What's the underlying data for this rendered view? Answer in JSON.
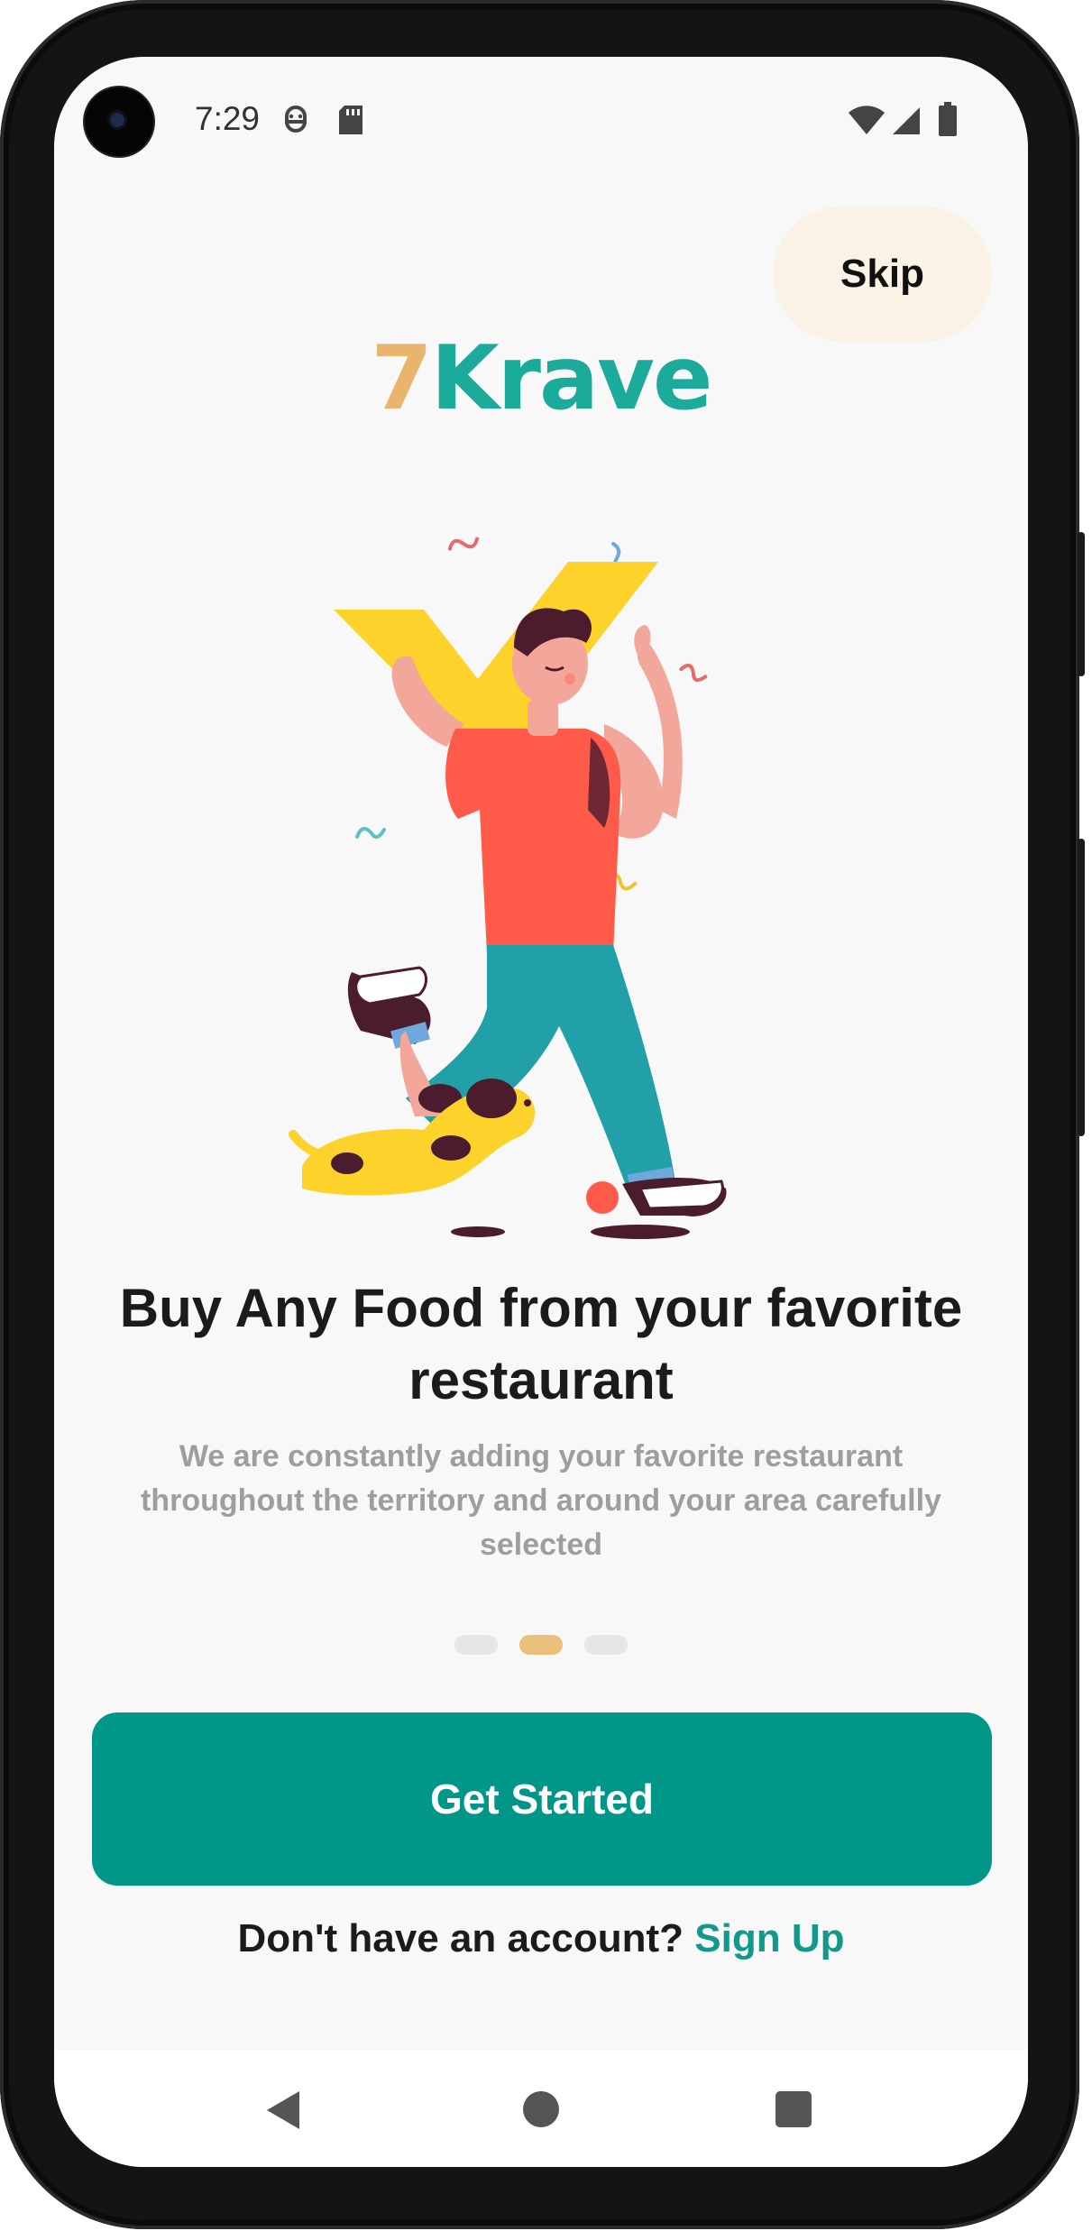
{
  "status_bar": {
    "time": "7:29",
    "icons": [
      "camera-cutout",
      "robot-notification-icon",
      "sd-card-icon",
      "wifi-icon",
      "cellular-signal-icon",
      "battery-icon"
    ]
  },
  "skip_label": "Skip",
  "logo": {
    "seven": "7",
    "name": "Krave"
  },
  "headline": "Buy Any Food from your favorite restaurant",
  "description": "We are constantly adding your favorite restaurant throughout the territory and around your area carefully selected",
  "pager": {
    "count": 3,
    "active_index": 1
  },
  "primary_button": "Get Started",
  "signup": {
    "prompt": "Don't have an account?",
    "link": "Sign Up"
  },
  "nav_bar": [
    "back-icon",
    "home-icon",
    "recents-icon"
  ],
  "colors": {
    "accent": "#009688",
    "logo_seven": "#e9b46c",
    "logo_krave": "#1aab9b",
    "skip_bg": "#fbf2e6",
    "active_dot": "#e9c07a"
  }
}
